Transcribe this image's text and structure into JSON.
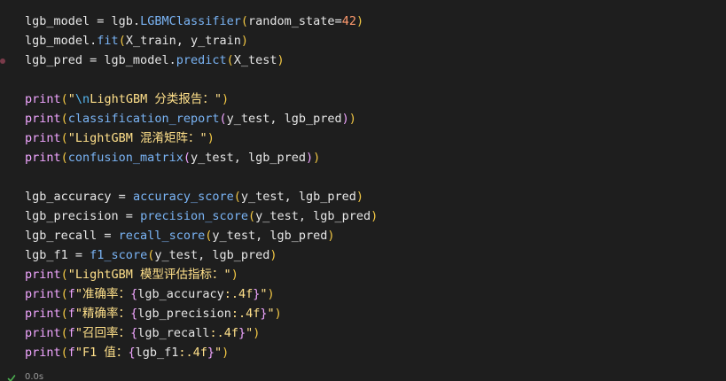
{
  "colors": {
    "background": "#1e1e1e",
    "default": "#e6e6e6",
    "function": "#f0a6ff",
    "method": "#7ab4f5",
    "string": "#ffe08a",
    "number": "#ff9a6e",
    "paren": "#f2c744",
    "escape": "#56b6f0",
    "status_text": "#9a9a9a",
    "check": "#4caf50"
  },
  "code_lines": [
    [
      {
        "text": "lgb_model",
        "kind": "default"
      },
      {
        "text": " = ",
        "kind": "default"
      },
      {
        "text": "lgb",
        "kind": "default"
      },
      {
        "text": ".",
        "kind": "default"
      },
      {
        "text": "LGBMClassifier",
        "kind": "method"
      },
      {
        "text": "(",
        "kind": "paren"
      },
      {
        "text": "random_state",
        "kind": "default"
      },
      {
        "text": "=",
        "kind": "default"
      },
      {
        "text": "42",
        "kind": "number"
      },
      {
        "text": ")",
        "kind": "paren"
      }
    ],
    [
      {
        "text": "lgb_model",
        "kind": "default"
      },
      {
        "text": ".",
        "kind": "default"
      },
      {
        "text": "fit",
        "kind": "method"
      },
      {
        "text": "(",
        "kind": "paren"
      },
      {
        "text": "X_train, y_train",
        "kind": "default"
      },
      {
        "text": ")",
        "kind": "paren"
      }
    ],
    [
      {
        "text": "lgb_pred",
        "kind": "default"
      },
      {
        "text": " = ",
        "kind": "default"
      },
      {
        "text": "lgb_model",
        "kind": "default"
      },
      {
        "text": ".",
        "kind": "default"
      },
      {
        "text": "predict",
        "kind": "method"
      },
      {
        "text": "(",
        "kind": "paren"
      },
      {
        "text": "X_test",
        "kind": "default"
      },
      {
        "text": ")",
        "kind": "paren"
      }
    ],
    [],
    [
      {
        "text": "print",
        "kind": "function"
      },
      {
        "text": "(",
        "kind": "paren"
      },
      {
        "text": "\"",
        "kind": "string"
      },
      {
        "text": "\\n",
        "kind": "escape"
      },
      {
        "text": "LightGBM 分类报告：\"",
        "kind": "string"
      },
      {
        "text": ")",
        "kind": "paren"
      }
    ],
    [
      {
        "text": "print",
        "kind": "function"
      },
      {
        "text": "(",
        "kind": "paren"
      },
      {
        "text": "classification_report",
        "kind": "method"
      },
      {
        "text": "(",
        "kind": "function"
      },
      {
        "text": "y_test, lgb_pred",
        "kind": "default"
      },
      {
        "text": ")",
        "kind": "function"
      },
      {
        "text": ")",
        "kind": "paren"
      }
    ],
    [
      {
        "text": "print",
        "kind": "function"
      },
      {
        "text": "(",
        "kind": "paren"
      },
      {
        "text": "\"LightGBM 混淆矩阵：\"",
        "kind": "string"
      },
      {
        "text": ")",
        "kind": "paren"
      }
    ],
    [
      {
        "text": "print",
        "kind": "function"
      },
      {
        "text": "(",
        "kind": "paren"
      },
      {
        "text": "confusion_matrix",
        "kind": "method"
      },
      {
        "text": "(",
        "kind": "function"
      },
      {
        "text": "y_test, lgb_pred",
        "kind": "default"
      },
      {
        "text": ")",
        "kind": "function"
      },
      {
        "text": ")",
        "kind": "paren"
      }
    ],
    [],
    [
      {
        "text": "lgb_accuracy",
        "kind": "default"
      },
      {
        "text": " = ",
        "kind": "default"
      },
      {
        "text": "accuracy_score",
        "kind": "method"
      },
      {
        "text": "(",
        "kind": "paren"
      },
      {
        "text": "y_test, lgb_pred",
        "kind": "default"
      },
      {
        "text": ")",
        "kind": "paren"
      }
    ],
    [
      {
        "text": "lgb_precision",
        "kind": "default"
      },
      {
        "text": " = ",
        "kind": "default"
      },
      {
        "text": "precision_score",
        "kind": "method"
      },
      {
        "text": "(",
        "kind": "paren"
      },
      {
        "text": "y_test, lgb_pred",
        "kind": "default"
      },
      {
        "text": ")",
        "kind": "paren"
      }
    ],
    [
      {
        "text": "lgb_recall",
        "kind": "default"
      },
      {
        "text": " = ",
        "kind": "default"
      },
      {
        "text": "recall_score",
        "kind": "method"
      },
      {
        "text": "(",
        "kind": "paren"
      },
      {
        "text": "y_test, lgb_pred",
        "kind": "default"
      },
      {
        "text": ")",
        "kind": "paren"
      }
    ],
    [
      {
        "text": "lgb_f1",
        "kind": "default"
      },
      {
        "text": " = ",
        "kind": "default"
      },
      {
        "text": "f1_score",
        "kind": "method"
      },
      {
        "text": "(",
        "kind": "paren"
      },
      {
        "text": "y_test, lgb_pred",
        "kind": "default"
      },
      {
        "text": ")",
        "kind": "paren"
      }
    ],
    [
      {
        "text": "print",
        "kind": "function"
      },
      {
        "text": "(",
        "kind": "paren"
      },
      {
        "text": "\"LightGBM 模型评估指标：\"",
        "kind": "string"
      },
      {
        "text": ")",
        "kind": "paren"
      }
    ],
    [
      {
        "text": "print",
        "kind": "function"
      },
      {
        "text": "(",
        "kind": "paren"
      },
      {
        "text": "f",
        "kind": "function"
      },
      {
        "text": "\"准确率：",
        "kind": "string"
      },
      {
        "text": "{",
        "kind": "function"
      },
      {
        "text": "lgb_accuracy",
        "kind": "default"
      },
      {
        "text": ":.4f",
        "kind": "string"
      },
      {
        "text": "}",
        "kind": "function"
      },
      {
        "text": "\"",
        "kind": "string"
      },
      {
        "text": ")",
        "kind": "paren"
      }
    ],
    [
      {
        "text": "print",
        "kind": "function"
      },
      {
        "text": "(",
        "kind": "paren"
      },
      {
        "text": "f",
        "kind": "function"
      },
      {
        "text": "\"精确率：",
        "kind": "string"
      },
      {
        "text": "{",
        "kind": "function"
      },
      {
        "text": "lgb_precision",
        "kind": "default"
      },
      {
        "text": ":.4f",
        "kind": "string"
      },
      {
        "text": "}",
        "kind": "function"
      },
      {
        "text": "\"",
        "kind": "string"
      },
      {
        "text": ")",
        "kind": "paren"
      }
    ],
    [
      {
        "text": "print",
        "kind": "function"
      },
      {
        "text": "(",
        "kind": "paren"
      },
      {
        "text": "f",
        "kind": "function"
      },
      {
        "text": "\"召回率：",
        "kind": "string"
      },
      {
        "text": "{",
        "kind": "function"
      },
      {
        "text": "lgb_recall",
        "kind": "default"
      },
      {
        "text": ":.4f",
        "kind": "string"
      },
      {
        "text": "}",
        "kind": "function"
      },
      {
        "text": "\"",
        "kind": "string"
      },
      {
        "text": ")",
        "kind": "paren"
      }
    ],
    [
      {
        "text": "print",
        "kind": "function"
      },
      {
        "text": "(",
        "kind": "paren"
      },
      {
        "text": "f",
        "kind": "function"
      },
      {
        "text": "\"F1 值：",
        "kind": "string"
      },
      {
        "text": "{",
        "kind": "function"
      },
      {
        "text": "lgb_f1",
        "kind": "default"
      },
      {
        "text": ":.4f",
        "kind": "string"
      },
      {
        "text": "}",
        "kind": "function"
      },
      {
        "text": "\"",
        "kind": "string"
      },
      {
        "text": ")",
        "kind": "paren"
      }
    ]
  ],
  "status": {
    "icon": "check-icon",
    "duration": "0.0s"
  }
}
